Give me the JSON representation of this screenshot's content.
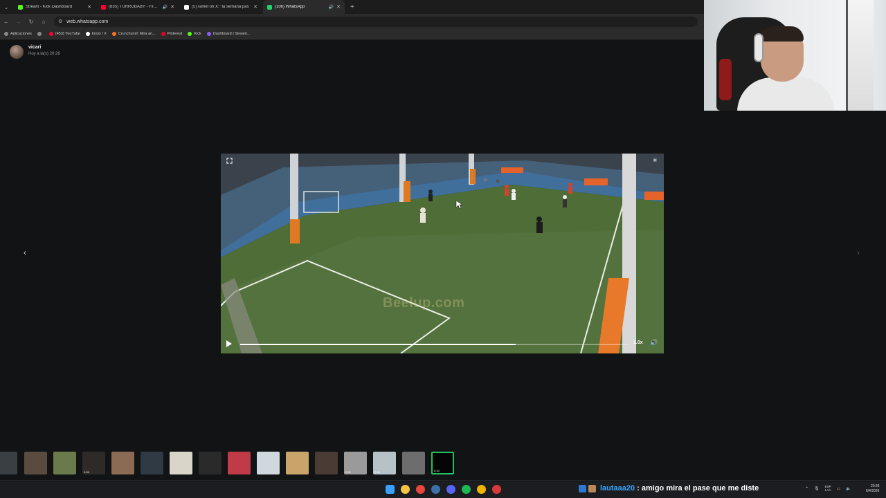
{
  "browser": {
    "tabs": [
      {
        "title": "Stream - Kick Dashboard",
        "favicon_color": "#53fc18",
        "active": false,
        "audio": false
      },
      {
        "title": "(835) TURROBABY - Filmen",
        "favicon_color": "#ff0033",
        "active": false,
        "audio": true
      },
      {
        "title": "(5) ramel on X: \"la semana pas",
        "favicon_color": "#ffffff",
        "active": false,
        "audio": false
      },
      {
        "title": "(106) WhatsApp",
        "favicon_color": "#25d366",
        "active": true,
        "audio": true
      }
    ],
    "url": "web.whatsapp.com",
    "bookmarks": [
      {
        "label": "Aplicaciones",
        "color": "#888888"
      },
      {
        "label": "",
        "color": "#888888"
      },
      {
        "label": "(453) YouTube",
        "color": "#ff0033"
      },
      {
        "label": "Inicio / X",
        "color": "#ffffff"
      },
      {
        "label": "Crunchyroll: Mira an...",
        "color": "#f47521"
      },
      {
        "label": "Pinterest",
        "color": "#e60023"
      },
      {
        "label": "Kick",
        "color": "#53fc18"
      },
      {
        "label": "Dashboard | Stream...",
        "color": "#8b5cf6"
      }
    ]
  },
  "chat_header": {
    "name": "vicari",
    "timestamp": "Hoy a la(s) 20:26"
  },
  "video": {
    "watermark": "Beelup.com",
    "speed": "1.0x",
    "progress": 0.71
  },
  "thumbnails": [
    {
      "color": "#3a3f44",
      "duration": ""
    },
    {
      "color": "#5b4a3e",
      "duration": ""
    },
    {
      "color": "#6a7a4a",
      "duration": ""
    },
    {
      "color": "#2e2a28",
      "duration": "0:26"
    },
    {
      "color": "#8c6b55",
      "duration": ""
    },
    {
      "color": "#2f3a44",
      "duration": ""
    },
    {
      "color": "#d9d5c8",
      "duration": ""
    },
    {
      "color": "#2a2a2a",
      "duration": ""
    },
    {
      "color": "#c03a48",
      "duration": ""
    },
    {
      "color": "#cfd8dc",
      "duration": ""
    },
    {
      "color": "#c9a46a",
      "duration": ""
    },
    {
      "color": "#4a3b35",
      "duration": ""
    },
    {
      "color": "#9a9a9a",
      "duration": "0:30"
    },
    {
      "color": "#b7c2c8",
      "duration": "0:09"
    },
    {
      "color": "#6d6d6d",
      "duration": ""
    },
    {
      "color": "#050505",
      "duration": "0:10"
    }
  ],
  "taskbar": {
    "icons": [
      {
        "name": "windows-start-icon",
        "color": "#3aa0ff"
      },
      {
        "name": "file-explorer-icon",
        "color": "#f6c343"
      },
      {
        "name": "chrome-icon",
        "color": "#e8453c"
      },
      {
        "name": "steam-icon",
        "color": "#3d6fa8"
      },
      {
        "name": "discord-icon",
        "color": "#5865f2"
      },
      {
        "name": "spotify-icon",
        "color": "#1db954"
      },
      {
        "name": "chrome-alt-icon",
        "color": "#f0b400"
      },
      {
        "name": "obs-icon",
        "color": "#d83a3a"
      }
    ],
    "chat_user": "lautaaa20",
    "chat_message": ": amigo mira el pase que me diste",
    "lang_top": "ESP",
    "lang_bottom": "LAA",
    "time": "20:28",
    "date": "6/4/2026"
  }
}
